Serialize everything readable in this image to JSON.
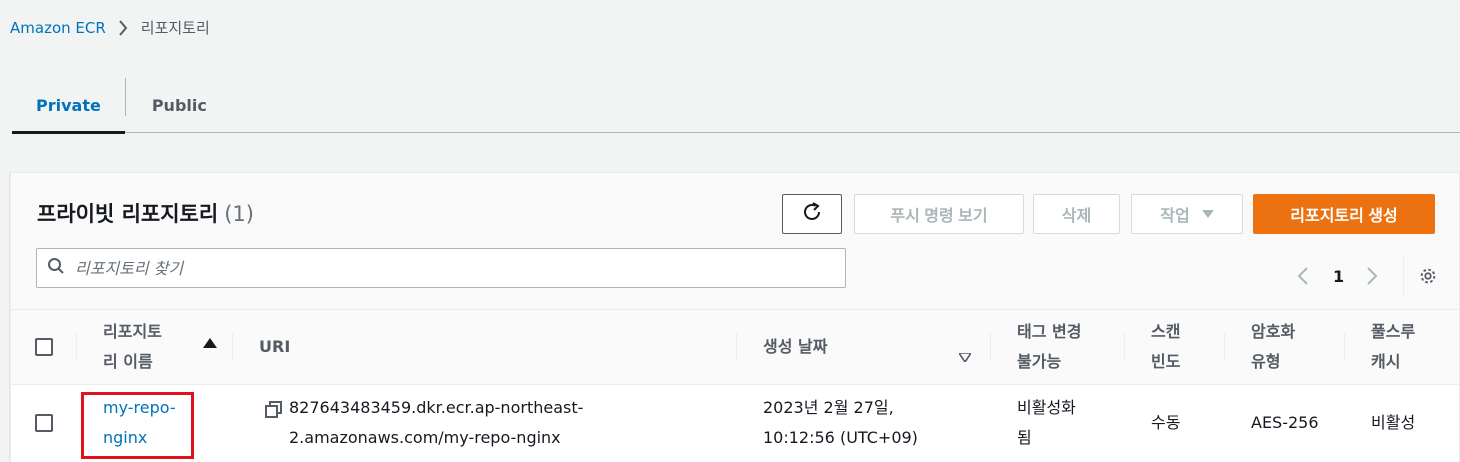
{
  "breadcrumb": {
    "link": "Amazon ECR",
    "current": "리포지토리"
  },
  "tabs": [
    {
      "label": "Private",
      "active": true
    },
    {
      "label": "Public",
      "active": false
    }
  ],
  "panel": {
    "title": "프라이빗 리포지토리",
    "count": "(1)"
  },
  "toolbar": {
    "push_label": "푸시 명령 보기",
    "delete_label": "삭제",
    "actions_label": "작업",
    "create_label": "리포지토리 생성"
  },
  "search": {
    "placeholder": "리포지토리 찾기"
  },
  "pagination": {
    "page": "1"
  },
  "table": {
    "columns": {
      "name_line1": "리포지토",
      "name_line2": "리 이름",
      "uri": "URI",
      "created": "생성 날짜",
      "immut_line1": "태그 변경",
      "immut_line2": "불가능",
      "scan_line1": "스캔",
      "scan_line2": "빈도",
      "enc_line1": "암호화",
      "enc_line2": "유형",
      "cache_line1": "풀스루",
      "cache_line2": "캐시"
    },
    "rows": [
      {
        "name_line1": "my-repo-",
        "name_line2": "nginx",
        "uri_line1": "827643483459.dkr.ecr.ap-northeast-",
        "uri_line2": "2.amazonaws.com/my-repo-nginx",
        "created_line1": "2023년 2월 27일,",
        "created_line2": "10:12:56 (UTC+09)",
        "immut_line1": "비활성화",
        "immut_line2": "됨",
        "scan": "수동",
        "encryption": "AES-256",
        "cache": "비활성"
      }
    ]
  },
  "colors": {
    "link": "#0073bb",
    "primary_button": "#ec7211",
    "highlight": "#e0131d"
  },
  "icons": [
    "chevron-right-icon",
    "refresh-icon",
    "caret-down-icon",
    "search-icon",
    "chevron-left-icon",
    "settings-gear-icon",
    "sort-asc-icon",
    "sort-desc-icon",
    "copy-icon"
  ]
}
